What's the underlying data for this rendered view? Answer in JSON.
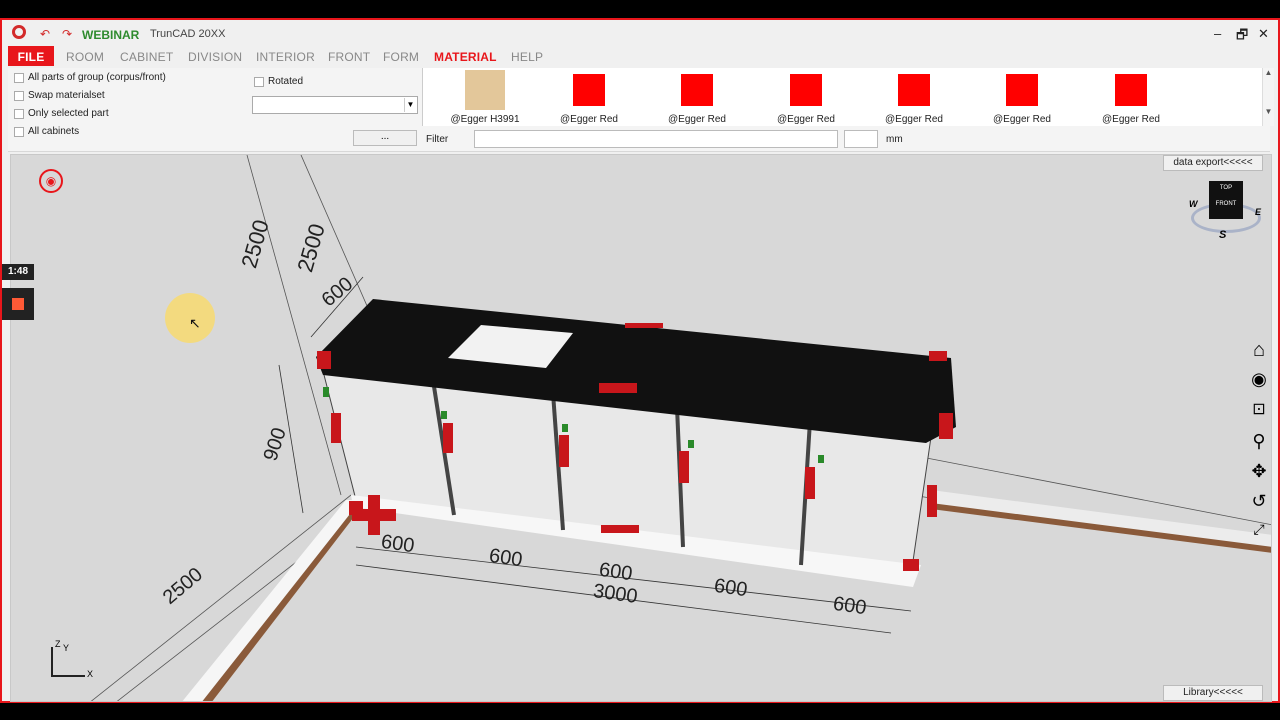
{
  "app": {
    "brand": "WEBINAR",
    "title": "TrunCAD 20XX",
    "window_controls": [
      "–",
      "🗗",
      "✕"
    ]
  },
  "menu": {
    "items": [
      "FILE",
      "ROOM",
      "CABINET",
      "DIVISION",
      "INTERIOR",
      "FRONT",
      "FORM",
      "MATERIAL",
      "HELP"
    ],
    "active": "MATERIAL"
  },
  "options": {
    "all_parts": "All parts of group (corpus/front)",
    "swap": "Swap materialset",
    "only_selected": "Only selected part",
    "all_cabinets": "All cabinets",
    "rotated": "Rotated",
    "dots_button": "..."
  },
  "materials": [
    {
      "name": "@Egger H3991",
      "color": "#e3c79a"
    },
    {
      "name": "@Egger Red",
      "color": "#ff0000"
    },
    {
      "name": "@Egger Red",
      "color": "#ff0000"
    },
    {
      "name": "@Egger Red",
      "color": "#ff0000"
    },
    {
      "name": "@Egger Red",
      "color": "#ff0000"
    },
    {
      "name": "@Egger Red",
      "color": "#ff0000"
    },
    {
      "name": "@Egger Red",
      "color": "#ff0000"
    }
  ],
  "filter": {
    "label": "Filter",
    "value": "",
    "unit": "mm"
  },
  "viewport": {
    "data_export": "data export<<<<<",
    "library": "Library<<<<<",
    "timer": "1:48",
    "viewcube": {
      "top": "TOP",
      "front": "FRONT",
      "w": "W",
      "e": "E",
      "s": "S"
    },
    "axis": {
      "x": "X",
      "y": "Y",
      "z": "Z"
    },
    "dimensions": {
      "wall_left": "2500",
      "wall_back": "2500",
      "wall_floor": "2500",
      "depth": "600",
      "height": "900",
      "widths": [
        "600",
        "600",
        "600",
        "600",
        "600"
      ],
      "total": "3000"
    }
  },
  "colors": {
    "accent": "#e8161b",
    "brand_green": "#2e8b2e",
    "countertop": "#111111",
    "edge_marker": "#c8161b",
    "swatch_wood": "#e3c79a"
  }
}
